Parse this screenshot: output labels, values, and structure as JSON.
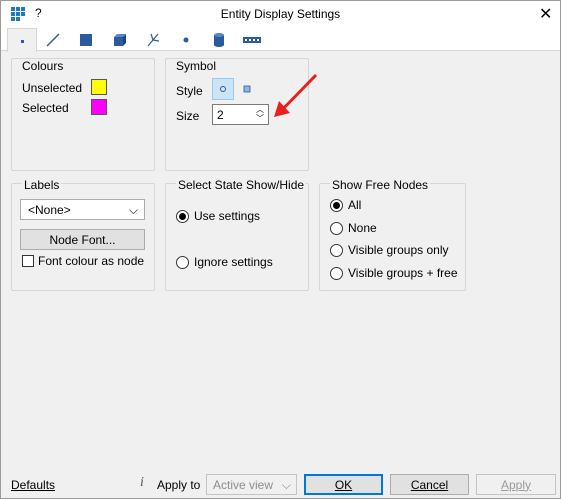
{
  "window": {
    "title": "Entity Display Settings",
    "help": "?"
  },
  "tabs": [
    {
      "name": "node-tab",
      "icon": "node-icon"
    },
    {
      "name": "line-tab",
      "icon": "line-icon"
    },
    {
      "name": "surface-tab",
      "icon": "surface-icon"
    },
    {
      "name": "volume-tab",
      "icon": "volume-icon"
    },
    {
      "name": "branch-tab",
      "icon": "branch-icon"
    },
    {
      "name": "point-tab",
      "icon": "point-icon"
    },
    {
      "name": "cylinder-tab",
      "icon": "cylinder-icon"
    },
    {
      "name": "dotted-tab",
      "icon": "dotted-line-icon"
    }
  ],
  "colours": {
    "title": "Colours",
    "unselected_label": "Unselected",
    "unselected_color": "#ffff00",
    "selected_label": "Selected",
    "selected_color": "#ff00ff"
  },
  "symbol": {
    "title": "Symbol",
    "style_label": "Style",
    "size_label": "Size",
    "size_value": "2"
  },
  "labels": {
    "title": "Labels",
    "dropdown_value": "<None>",
    "node_font_button": "Node Font...",
    "font_colour_checkbox": "Font colour as node"
  },
  "select_state": {
    "title": "Select State Show/Hide",
    "use_settings": "Use settings",
    "ignore_settings": "Ignore settings"
  },
  "free_nodes": {
    "title": "Show Free Nodes",
    "options": [
      "All",
      "None",
      "Visible groups only",
      "Visible groups + free"
    ]
  },
  "footer": {
    "defaults": "Defaults",
    "apply_to_label": "Apply to",
    "apply_to_value": "Active view",
    "ok": "OK",
    "cancel": "Cancel",
    "apply": "Apply"
  },
  "annotation_color": "#e8201e"
}
